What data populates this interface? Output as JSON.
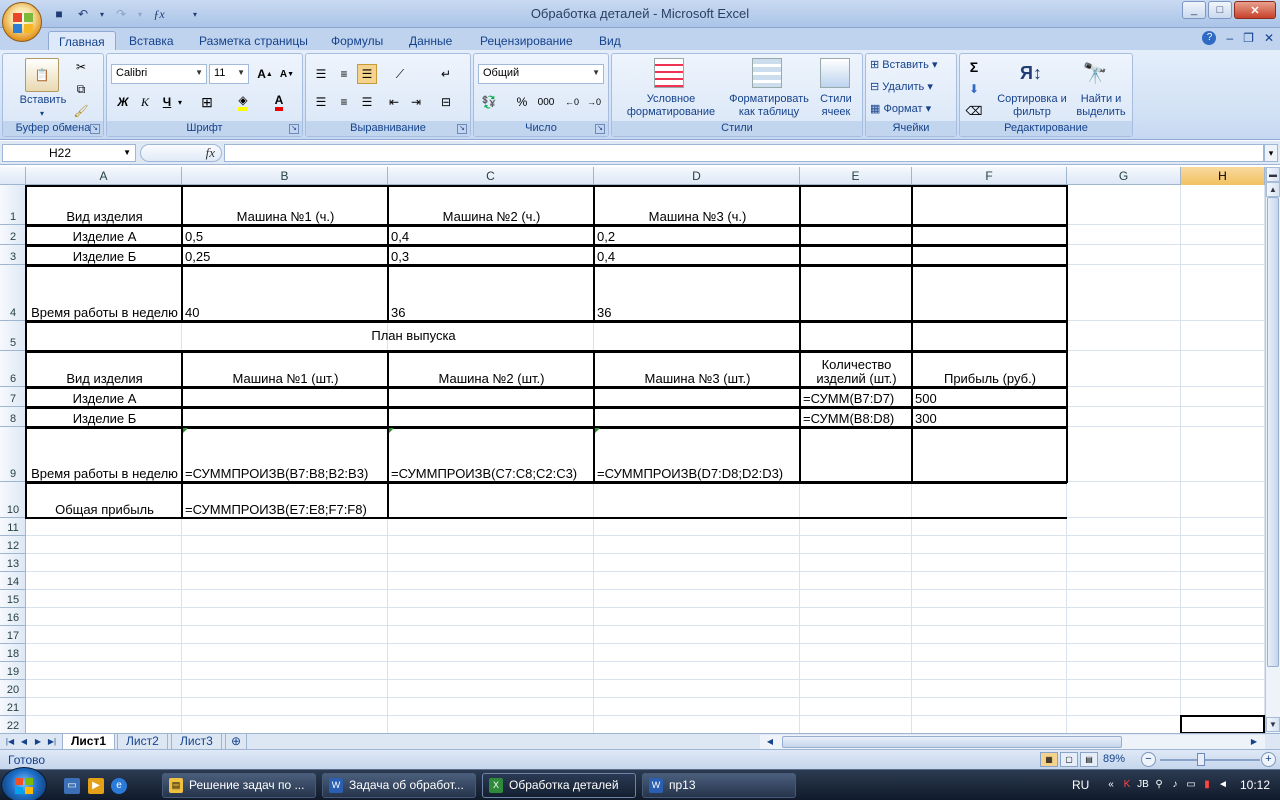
{
  "window": {
    "title": "Обработка деталей - Microsoft Excel"
  },
  "ribbon_tabs": [
    "Главная",
    "Вставка",
    "Разметка страницы",
    "Формулы",
    "Данные",
    "Рецензирование",
    "Вид"
  ],
  "ribbon": {
    "clipboard": {
      "label": "Буфер обмена",
      "paste": "Вставить"
    },
    "font": {
      "label": "Шрифт",
      "name": "Calibri",
      "size": "11",
      "bold": "Ж",
      "italic": "К",
      "underline": "Ч"
    },
    "alignment": {
      "label": "Выравнивание"
    },
    "number": {
      "label": "Число",
      "format": "Общий",
      "percent": "%",
      "thousands": "000"
    },
    "styles": {
      "label": "Стили",
      "conditional": "Условное форматирование",
      "as_table": "Форматировать как таблицу",
      "cell_styles": "Стили ячеек"
    },
    "cells": {
      "label": "Ячейки",
      "insert": "Вставить",
      "delete": "Удалить",
      "format": "Формат"
    },
    "editing": {
      "label": "Редактирование",
      "sort": "Сортировка и фильтр",
      "find": "Найти и выделить"
    }
  },
  "formula_bar": {
    "name_box": "H22",
    "fx": "fx",
    "formula": ""
  },
  "columns": [
    "A",
    "B",
    "C",
    "D",
    "E",
    "F",
    "G",
    "H"
  ],
  "rows": [
    "1",
    "2",
    "3",
    "4",
    "5",
    "6",
    "7",
    "8",
    "9",
    "10",
    "11",
    "12",
    "13",
    "14",
    "15",
    "16",
    "17",
    "18",
    "19",
    "20",
    "21",
    "22"
  ],
  "cells": {
    "A1": "Вид изделия",
    "B1": "Машина №1 (ч.)",
    "C1": "Машина №2 (ч.)",
    "D1": "Машина №3 (ч.)",
    "A2": "Изделие А",
    "B2": "0,5",
    "C2": "0,4",
    "D2": "0,2",
    "A3": "Изделие Б",
    "B3": "0,25",
    "C3": "0,3",
    "D3": "0,4",
    "A4": "Время работы в неделю",
    "B4": "40",
    "C4": "36",
    "D4": "36",
    "A5": "План выпуска",
    "A6": "Вид изделия",
    "B6": "Машина №1 (шт.)",
    "C6": "Машина №2 (шт.)",
    "D6": "Машина №3 (шт.)",
    "E6": "Количество изделий (шт.)",
    "F6": "Прибыль (руб.)",
    "A7": "Изделие А",
    "E7": "=СУММ(B7:D7)",
    "F7": "500",
    "A8": "Изделие Б",
    "E8": "=СУММ(B8:D8)",
    "F8": "300",
    "A9": "Время работы в неделю",
    "B9": "=СУММПРОИЗВ(B7:B8;B2:B3)",
    "C9": "=СУММПРОИЗВ(C7:C8;C2:C3)",
    "D9": "=СУММПРОИЗВ(D7:D8;D2:D3)",
    "A10": "Общая прибыль",
    "B10": "=СУММПРОИЗВ(E7:E8;F7:F8)"
  },
  "sheets": [
    "Лист1",
    "Лист2",
    "Лист3"
  ],
  "status": {
    "text": "Готово",
    "zoom": "89%"
  },
  "taskbar": {
    "items": [
      "Решение задач по ...",
      "Задача об обработ...",
      "Обработка деталей",
      "пр13"
    ],
    "lang": "RU",
    "clock": "10:12"
  }
}
